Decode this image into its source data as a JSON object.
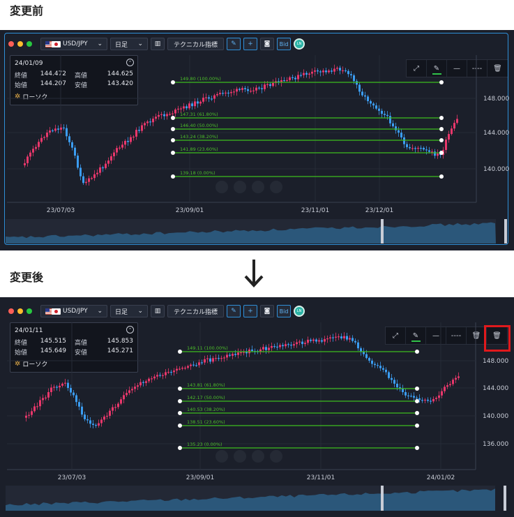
{
  "labels": {
    "before": "変更前",
    "after": "変更後"
  },
  "colors": {
    "up": "#e8376b",
    "down": "#3b9cf0",
    "fib": "#3cbd1e",
    "accent": "#2f8fd8",
    "highlight": "#e0191c",
    "background": "#1b1f2a"
  },
  "toolbar": {
    "symbol": "USD/JPY",
    "period": "日足",
    "technical": "テクニカル指標",
    "bid": "Bid",
    "icons": [
      "candlestick-settings-icon",
      "pen-icon",
      "plus-icon",
      "camera-icon",
      "bid-button",
      "app-logo-icon"
    ]
  },
  "drawing_toolbar": {
    "icons": [
      "expand-icon",
      "pen-icon",
      "line-icon",
      "dashed-line-icon",
      "trash-icon",
      "trash-all-icon"
    ]
  },
  "before": {
    "info": {
      "date": "24/01/09",
      "close_label": "終値",
      "close": "144.472",
      "high_label": "高値",
      "high": "144.625",
      "open_label": "始値",
      "open": "144.207",
      "low_label": "安値",
      "low": "143.420",
      "candle_type": "ローソク"
    },
    "fib_levels": [
      "149.80 (100.00%)",
      "147.31 (61.80%)",
      "146.40 (50.00%)",
      "143.24 (38.20%)",
      "141.89 (23.60%)",
      "139.18 (0.00%)"
    ],
    "y_ticks": [
      "148.000",
      "144.000",
      "140.000"
    ],
    "x_ticks": [
      "23/07/03",
      "23/09/01",
      "23/11/01",
      "23/12/01"
    ]
  },
  "after": {
    "info": {
      "date": "24/01/11",
      "close_label": "終値",
      "close": "145.515",
      "high_label": "高値",
      "high": "145.853",
      "open_label": "始値",
      "open": "145.649",
      "low_label": "安値",
      "low": "145.271",
      "candle_type": "ローソク"
    },
    "fib_levels": [
      "149.11 (100.00%)",
      "143.81 (61.80%)",
      "142.17 (50.00%)",
      "140.53 (38.20%)",
      "138.51 (23.60%)",
      "135.23 (0.00%)"
    ],
    "y_ticks": [
      "148.000",
      "144.000",
      "140.000",
      "136.000"
    ],
    "x_ticks": [
      "23/07/03",
      "23/09/01",
      "23/11/01",
      "24/01/02"
    ]
  }
}
